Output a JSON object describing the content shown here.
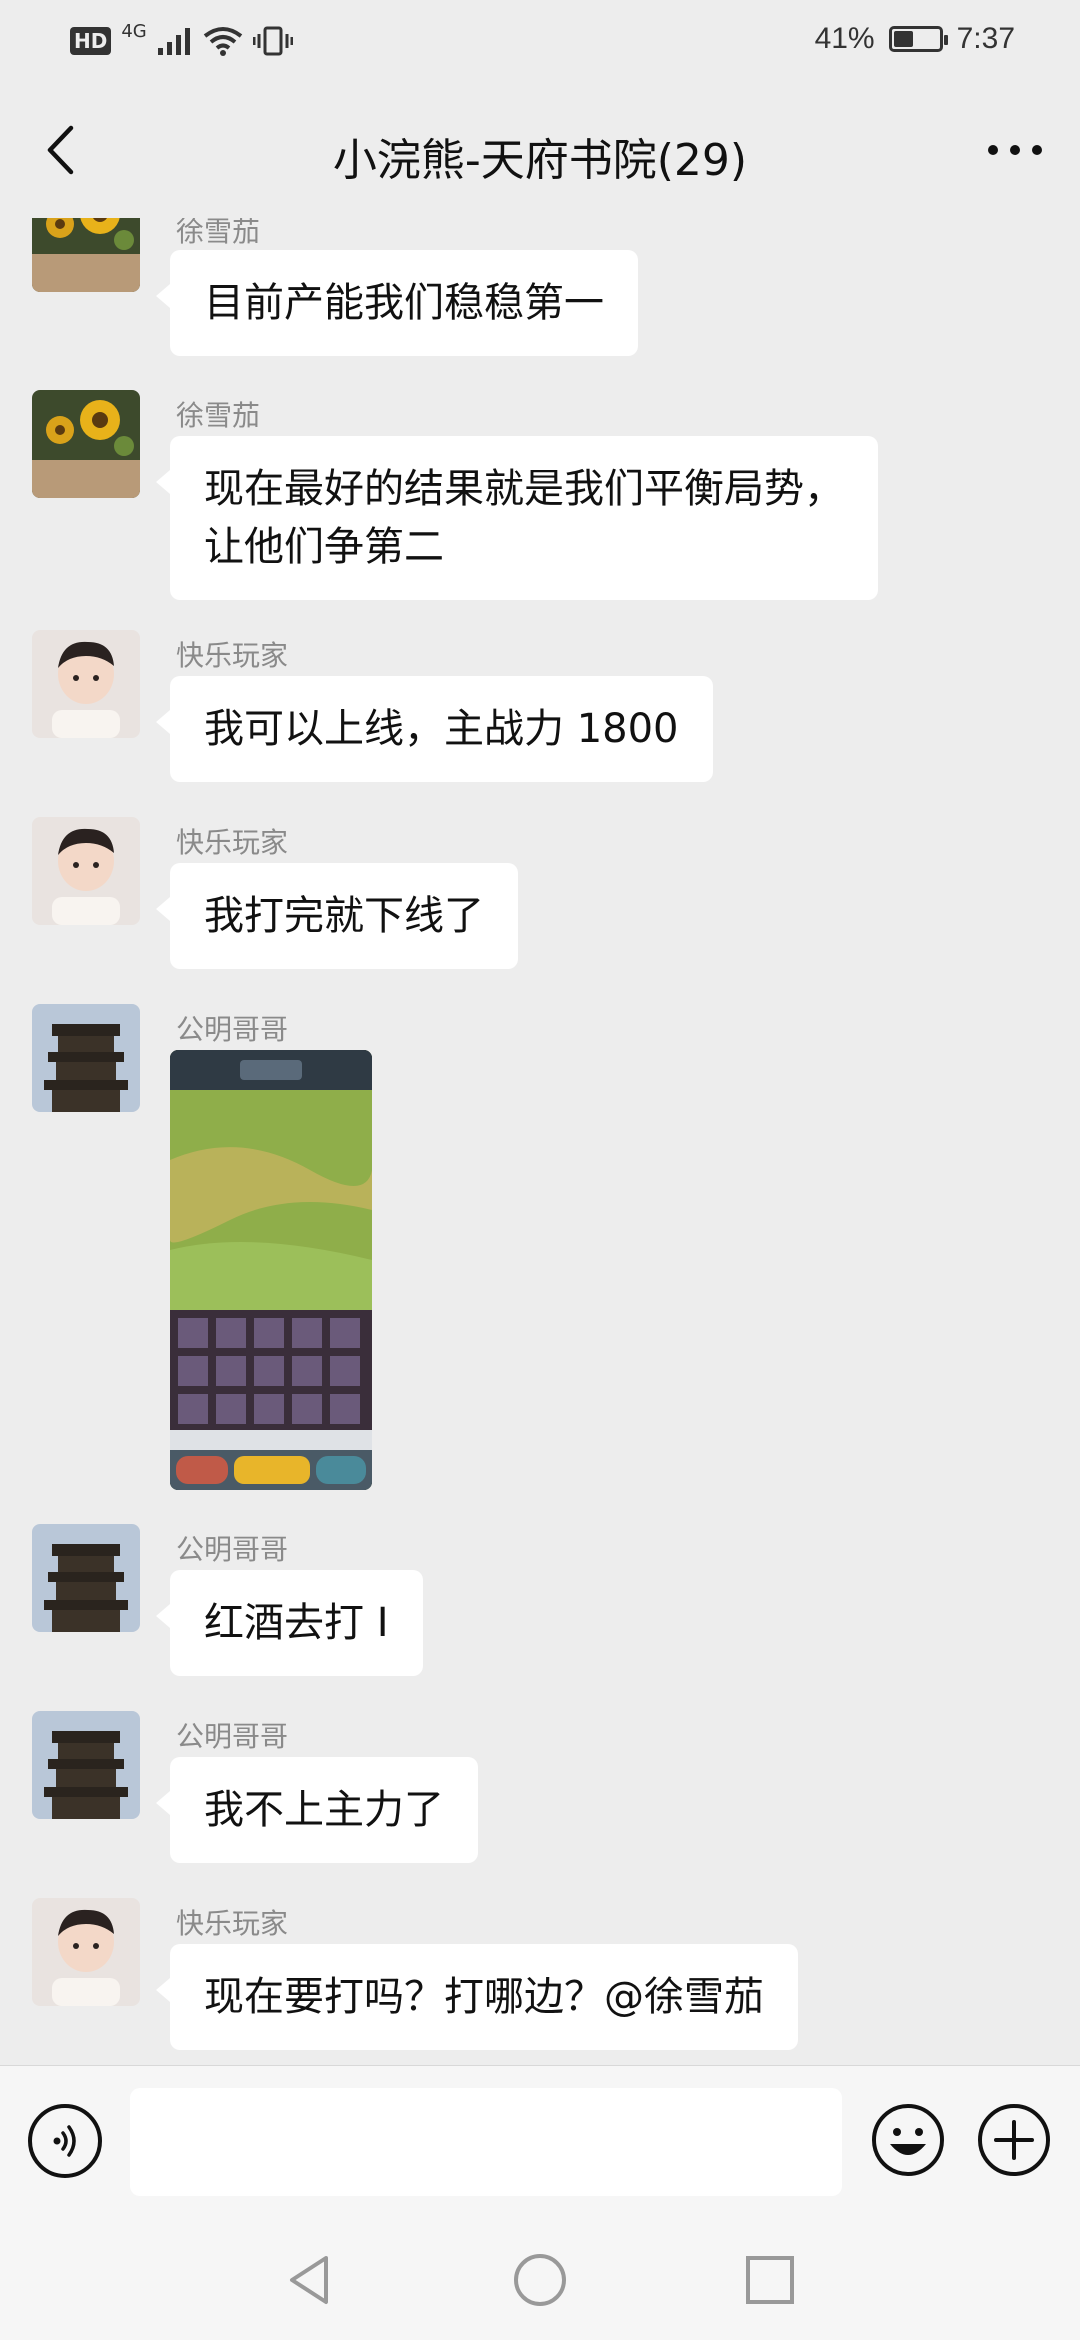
{
  "status_bar": {
    "hd_label": "HD",
    "network_label": "4G",
    "battery_text": "41%",
    "battery_level": 0.41,
    "time": "7:37",
    "icons": [
      "signal-icon",
      "wifi-icon",
      "vibrate-icon",
      "battery-icon"
    ]
  },
  "header": {
    "title": "小浣熊-天府书院(29)",
    "back_icon": "back-chevron-icon",
    "more_icon": "more-dots-icon"
  },
  "messages": [
    {
      "sender": "徐雪茄",
      "text": "目前产能我们稳稳第一",
      "avatar": "sunflower"
    },
    {
      "sender": "徐雪茄",
      "text": "现在最好的结果就是我们平衡局势，让他们争第二",
      "avatar": "sunflower"
    },
    {
      "sender": "快乐玩家",
      "text": "我可以上线，主战力 1800",
      "avatar": "baby"
    },
    {
      "sender": "快乐玩家",
      "text": "我打完就下线了",
      "avatar": "baby"
    },
    {
      "sender": "公明哥哥",
      "image": "game-screenshot",
      "avatar": "tower"
    },
    {
      "sender": "公明哥哥",
      "text": "红酒去打 I",
      "avatar": "tower"
    },
    {
      "sender": "公明哥哥",
      "text": "我不上主力了",
      "avatar": "tower"
    },
    {
      "sender": "快乐玩家",
      "text": "现在要打吗？打哪边？@徐雪茄",
      "avatar": "baby"
    }
  ],
  "input": {
    "placeholder": "",
    "value": ""
  },
  "colors": {
    "background": "#ededed",
    "bubble": "#ffffff",
    "sender_name": "#8a8a8a",
    "text": "#111111"
  }
}
